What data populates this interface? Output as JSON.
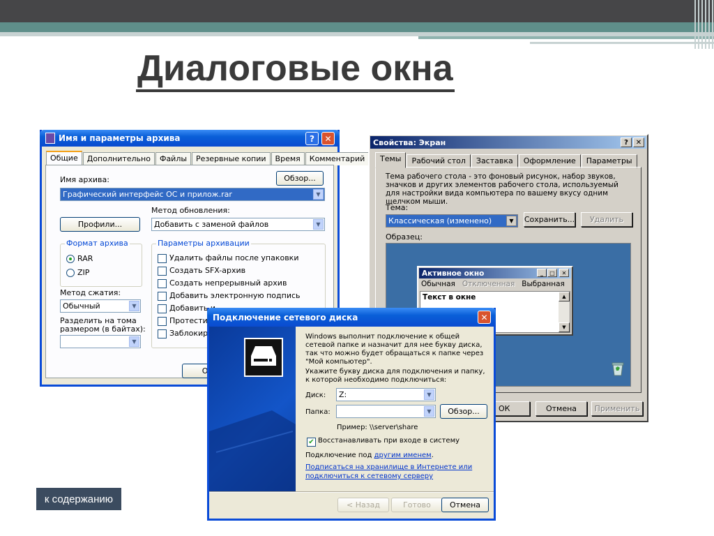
{
  "slide": {
    "title": "Диалоговые окна",
    "contents_button": "к содержанию"
  },
  "archive_dialog": {
    "title": "Имя и параметры архива",
    "help": "?",
    "close": "✕",
    "tabs": [
      "Общие",
      "Дополнительно",
      "Файлы",
      "Резервные копии",
      "Время",
      "Комментарий"
    ],
    "archive_name_label": "Имя архива:",
    "browse_button": "Обзор...",
    "archive_name_value": "Графический интерфейс ОС и прилож.rar",
    "update_method_label": "Метод обновления:",
    "profiles_button": "Профили...",
    "update_method_value": "Добавить с заменой файлов",
    "format_group": "Формат архива",
    "format_rar": "RAR",
    "format_zip": "ZIP",
    "compression_label": "Метод сжатия:",
    "compression_value": "Обычный",
    "split_label_1": "Разделить на тома",
    "split_label_2": "размером (в байтах):",
    "split_value": "",
    "options_group": "Параметры архивации",
    "options": [
      {
        "label": "Удалить файлы после упаковки",
        "checked": false
      },
      {
        "label": "Создать SFX-архив",
        "checked": false
      },
      {
        "label": "Создать непрерывный архив",
        "checked": false
      },
      {
        "label": "Добавить электронную подпись",
        "checked": false
      },
      {
        "label": "Добавить и",
        "checked": false
      },
      {
        "label": "Протестиро",
        "checked": false
      },
      {
        "label": "Заблокиров",
        "checked": false
      }
    ],
    "ok_button": "ОК"
  },
  "display_dialog": {
    "title": "Свойства: Экран",
    "help": "?",
    "close": "✕",
    "tabs": [
      "Темы",
      "Рабочий стол",
      "Заставка",
      "Оформление",
      "Параметры"
    ],
    "description": "Тема рабочего стола - это фоновый рисунок, набор звуков, значков и других элементов рабочего стола, используемый для настройки вида компьютера по вашему вкусу одним щелчком мыши.",
    "theme_label": "Тема:",
    "theme_value": "Классическая (изменено)",
    "save_button": "Сохранить...",
    "delete_button": "Удалить",
    "sample_label": "Образец:",
    "preview": {
      "title": "Активное окно",
      "menu": [
        "Обычная",
        "Отключенная",
        "Выбранная"
      ],
      "text": "Текст в окне"
    },
    "ok_button": "ОК",
    "cancel_button": "Отмена",
    "apply_button": "Применить"
  },
  "network_dialog": {
    "title": "Подключение сетевого диска",
    "close": "✕",
    "intro": "Windows выполнит подключение к общей сетевой папке и назначит для нее букву диска, так что можно будет обращаться к папке через \"Мой компьютер\".",
    "instruction": "Укажите букву диска для подключения и папку, к которой необходимо подключиться:",
    "drive_label": "Диск:",
    "drive_value": "Z:",
    "folder_label": "Папка:",
    "folder_value": "",
    "browse_button": "Обзор...",
    "example": "Пример: \\\\server\\share",
    "reconnect_label": "Восстанавливать при входе в систему",
    "reconnect_checked": true,
    "connect_as_prefix": "Подключение под ",
    "connect_as_link": "другим именем",
    "connect_as_suffix": ".",
    "storage_link_1": "Подписаться на хранилище в Интернете или",
    "storage_link_2": "подключиться к сетевому серверу",
    "back_button": "< Назад",
    "finish_button": "Готово",
    "cancel_button": "Отмена"
  }
}
